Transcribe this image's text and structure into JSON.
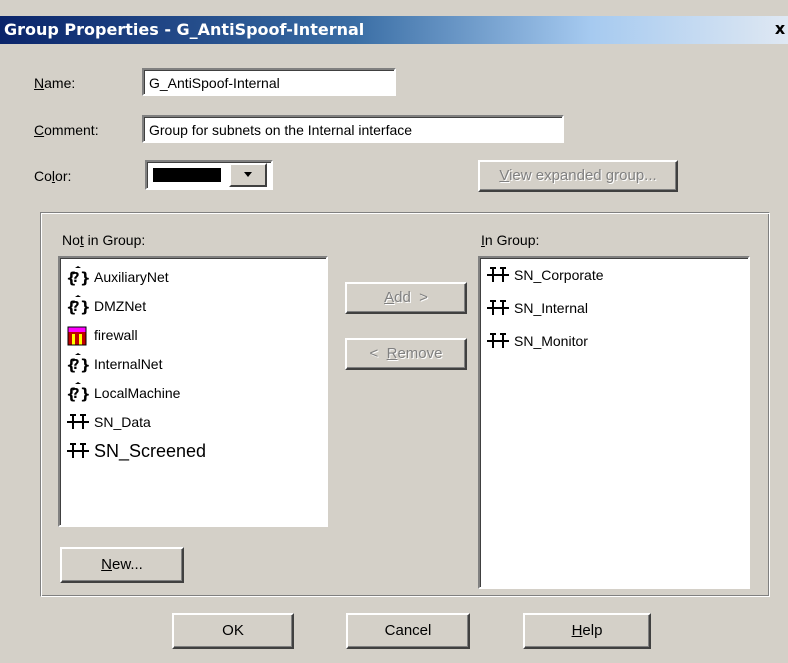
{
  "dialog": {
    "title": "Group Properties - G_AntiSpoof-Internal",
    "close_glyph": "x"
  },
  "name_field": {
    "label_first": "N",
    "label_rest": "ame:",
    "value": "G_AntiSpoof-Internal"
  },
  "comment_field": {
    "label_first": "C",
    "label_rest": "omment:",
    "value": "Group for subnets on the Internal interface"
  },
  "color_field": {
    "label_pre": "Co",
    "label_u": "l",
    "label_post": "or:",
    "value_color": "#000000"
  },
  "view_expanded_button": {
    "label_first": "V",
    "label_rest": "iew expanded group..."
  },
  "not_in_group": {
    "label_pre": "No",
    "label_u": "t",
    "label_post": " in Group:",
    "items": [
      {
        "label": "AuxiliaryNet",
        "icon": "network-object-icon"
      },
      {
        "label": "DMZNet",
        "icon": "network-object-icon"
      },
      {
        "label": "firewall",
        "icon": "firewall-icon"
      },
      {
        "label": "InternalNet",
        "icon": "network-object-icon"
      },
      {
        "label": "LocalMachine",
        "icon": "network-object-icon"
      },
      {
        "label": "SN_Data",
        "icon": "subnet-icon"
      },
      {
        "label": "SN_Screened",
        "icon": "subnet-icon"
      }
    ]
  },
  "in_group": {
    "label_first": "I",
    "label_rest": "n Group:",
    "items": [
      {
        "label": "SN_Corporate",
        "icon": "subnet-icon"
      },
      {
        "label": "SN_Internal",
        "icon": "subnet-icon"
      },
      {
        "label": "SN_Monitor",
        "icon": "subnet-icon"
      }
    ]
  },
  "add_button": {
    "label_first": "A",
    "label_rest": "dd  >"
  },
  "remove_button": {
    "label_pre": "<  ",
    "label_first": "R",
    "label_rest": "emove"
  },
  "new_button": {
    "label_first": "N",
    "label_rest": "ew..."
  },
  "ok_button": {
    "label": "OK"
  },
  "cancel_button": {
    "label": "Cancel"
  },
  "help_button": {
    "label_first": "H",
    "label_rest": "elp"
  },
  "colors": {
    "title_start": "#0a246a",
    "face": "#d4d0c8",
    "disabled_text": "#808080"
  }
}
